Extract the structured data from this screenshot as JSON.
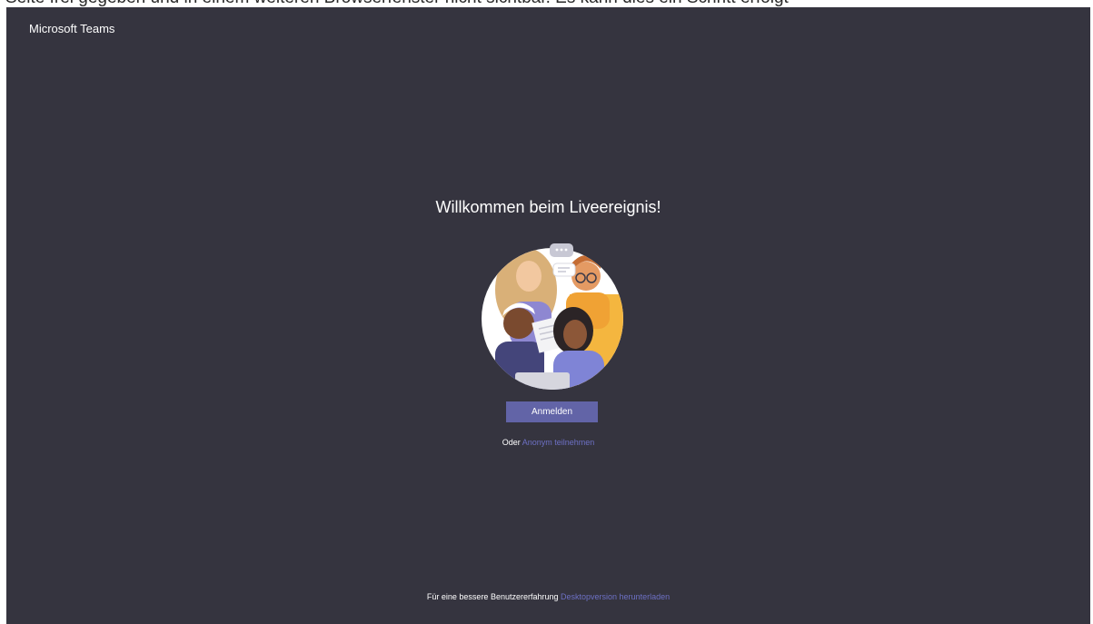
{
  "window": {
    "app_title": "Microsoft Teams",
    "top_strip_text": "Seite frei gegeben und in einem weiteren Browserfenster nicht sichtbar. Es kann dies ein Schritt erfolgt"
  },
  "main": {
    "welcome_title": "Willkommen beim Liveereignis!",
    "signin_label": "Anmelden",
    "or_label": "Oder",
    "anonymous_link": "Anonym teilnehmen"
  },
  "footer": {
    "text": "Für eine bessere Benutzererfahrung",
    "download_link": "Desktopversion herunterladen"
  },
  "colors": {
    "background": "#35343f",
    "accent": "#6264a7",
    "link": "#6d70c4"
  }
}
